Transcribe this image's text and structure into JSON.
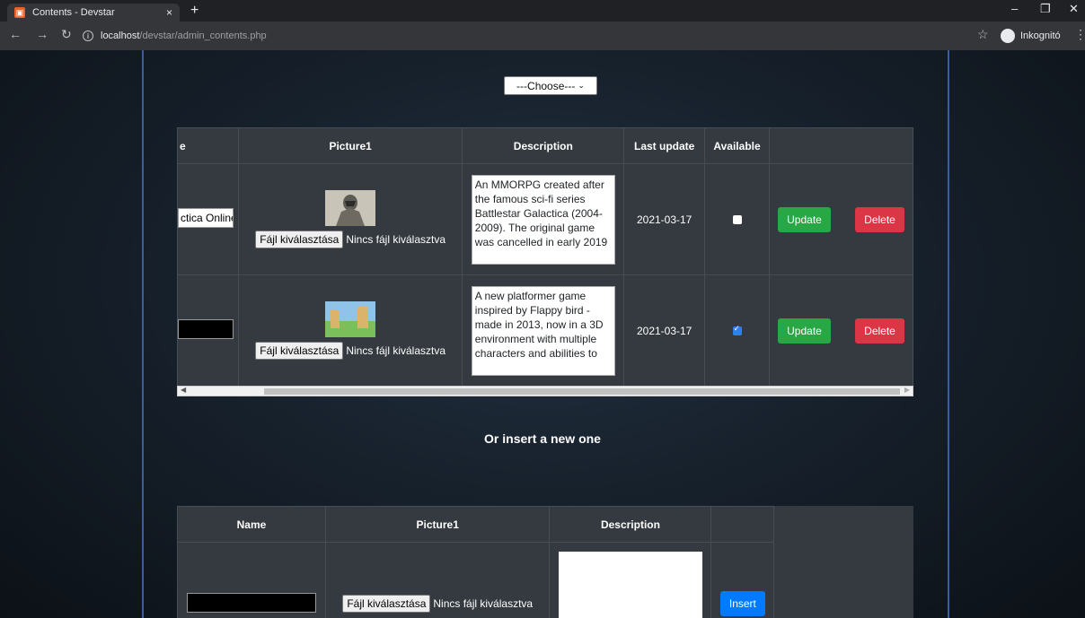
{
  "browser": {
    "tab_title": "Contents - Devstar",
    "tab_close": "×",
    "new_tab": "+",
    "url_host": "localhost",
    "url_path": "/devstar/admin_contents.php",
    "profile_label": "Inkognitó"
  },
  "filter": {
    "selected": "---Choose---"
  },
  "content_table": {
    "headers": [
      "e",
      "Picture1",
      "Description",
      "Last update",
      "Available",
      ""
    ],
    "rows": [
      {
        "name_value": "ctica Online",
        "file_button": "Fájl kiválasztása",
        "file_status": "Nincs fájl kiválasztva",
        "description": "An MMORPG created after the famous sci-fi series Battlestar Galactica (2004-2009). The original game was cancelled in early 2019",
        "last_update": "2021-03-17",
        "available": false,
        "update_label": "Update",
        "delete_label": "Delete"
      },
      {
        "name_value": "",
        "file_button": "Fájl kiválasztása",
        "file_status": "Nincs fájl kiválasztva",
        "description": "A new platformer game inspired by Flappy bird - made in 2013, now in a 3D environment with multiple characters and abilities to",
        "last_update": "2021-03-17",
        "available": true,
        "update_label": "Update",
        "delete_label": "Delete"
      }
    ]
  },
  "insert_section": {
    "heading": "Or insert a new one",
    "headers": [
      "Name",
      "Picture1",
      "Description",
      ""
    ],
    "file_button": "Fájl kiválasztása",
    "file_status": "Nincs fájl kiválasztva",
    "insert_label": "Insert"
  },
  "colors": {
    "update": "#28a745",
    "delete": "#dc3545",
    "insert": "#007bff",
    "table_bg": "#343a40"
  }
}
